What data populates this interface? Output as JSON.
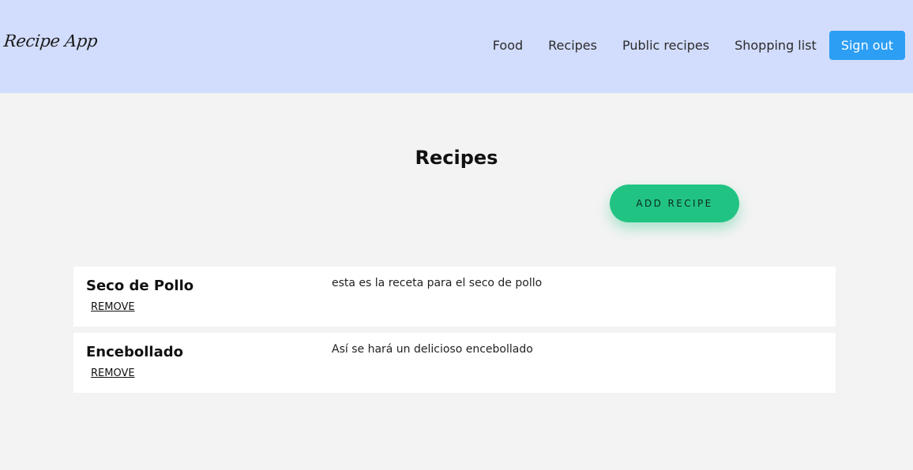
{
  "header": {
    "brand": "Recipe App",
    "nav": [
      "Food",
      "Recipes",
      "Public recipes",
      "Shopping list"
    ],
    "signout_label": "Sign out"
  },
  "main": {
    "title": "Recipes",
    "add_button_label": "ADD RECIPE",
    "recipes": [
      {
        "name": "Seco de Pollo",
        "description": "esta es la receta para el seco de pollo",
        "remove_label": "REMOVE"
      },
      {
        "name": "Encebollado",
        "description": "Así se hará un delicioso encebollado",
        "remove_label": "REMOVE"
      }
    ]
  },
  "colors": {
    "header_bg": "#d2ddfd",
    "page_bg": "#f3f3f3",
    "signout_bg": "#2c9ef4",
    "add_button_bg": "#21c383"
  }
}
